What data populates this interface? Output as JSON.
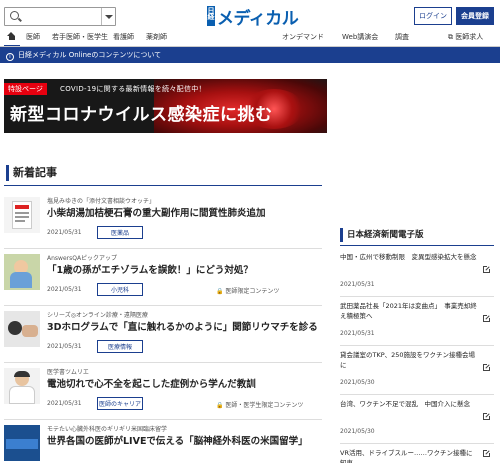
{
  "header": {
    "logo_prefix": "日経",
    "logo_name": "メディカル",
    "login_label": "ログイン",
    "register_label": "会員登録"
  },
  "nav": {
    "items": [
      "医師",
      "若手医師・医学生",
      "看護師",
      "薬剤師"
    ],
    "right": [
      "オンデマンド",
      "Web講演会",
      "調査",
      "医師求人"
    ]
  },
  "notice": "日経メディカル Onlineのコンテンツについて",
  "banner": {
    "tag": "特設ページ",
    "sub": "COVID-19に関する最新情報を続々配信中！",
    "main": "新型コロナウイルス感染症に挑む"
  },
  "section_title": "新着記事",
  "articles": [
    {
      "category": "塩見みゆきの「添付文書相談ウオッチ」",
      "title": "小柴胡湯加桔梗石膏の重大副作用に間質性肺炎追加",
      "date": "2021/05/31",
      "tag": "医薬品",
      "lock": ""
    },
    {
      "category": "AnswersQAピックアップ",
      "title": "「1歳の孫がエチゾラムを誤飲！」にどう対処？",
      "date": "2021/05/31",
      "tag": "小児科",
      "lock": "医師限定コンテンツ"
    },
    {
      "category": "シリーズ◎オンライン診療・遠隔医療",
      "title": "3Dホログラムで「直に触れるかのように」関節リウマチを診る",
      "date": "2021/05/31",
      "tag": "医療情報",
      "lock": ""
    },
    {
      "category": "医学書ツムリエ",
      "title": "電池切れで心不全を起こした症例から学んだ教訓",
      "date": "2021/05/31",
      "tag": "医師のキャリア",
      "lock": "医師・医学生限定コンテンツ"
    },
    {
      "category": "モテたい心臓外科医のギリギリ米国臨床留学",
      "title": "世界各国の医師がLIVEで伝える「脳神経外科医の米国留学」",
      "date": "",
      "tag": "",
      "lock": ""
    }
  ],
  "sidebar": {
    "title": "日本経済新聞電子版",
    "items": [
      {
        "title": "中国・広州で移動制限　変異型感染拡大を懸念",
        "date": "2021/05/31"
      },
      {
        "title": "武田薬品社長「2021年は変曲点」　事業売却終え積極策へ",
        "date": "2021/05/31"
      },
      {
        "title": "貸会議室のTKP、250施設をワクチン接種会場に",
        "date": "2021/05/30"
      },
      {
        "title": "台湾、ワクチン不足で混乱　中国介入に懸念",
        "date": "2021/05/30"
      },
      {
        "title": "VR活用、ドライブスルー……ワクチン接種に知恵",
        "date": ""
      }
    ]
  }
}
